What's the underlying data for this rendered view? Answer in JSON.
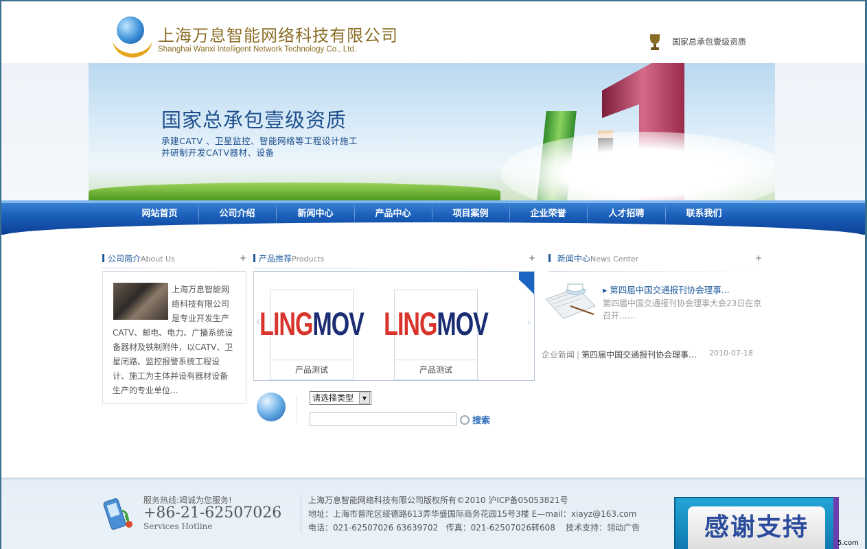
{
  "header": {
    "company_cn": "上海万息智能网络科技有限公司",
    "company_en": "Shanghai Wanxi Intelligent Network Technology Co., Ltd.",
    "qualification": "国家总承包壹级资质"
  },
  "banner": {
    "title": "国家总承包壹级资质",
    "line1": "承建CATV 、卫星监控、智能网络等工程设计施工",
    "line2": "并研制开发CATV器材、设备"
  },
  "nav": [
    "网站首页",
    "公司介绍",
    "新闻中心",
    "产品中心",
    "项目案例",
    "企业荣誉",
    "人才招聘",
    "联系我们"
  ],
  "about": {
    "title": "公司简介",
    "title_en": "About Us",
    "more": "+",
    "text": "上海万息智能网络科技有限公司是专业开发生产CATV、邮电、电力、广播系统设备器材及铁制附件，以CATV、卫星闭路、监控报警系统工程设计、施工为主体并设有器材设备生产的专业单位..."
  },
  "products": {
    "title": "产品推荐",
    "title_en": "Products",
    "more": "+",
    "items": [
      {
        "logo_a": "LING",
        "logo_b": "MOV",
        "caption": "产品测试"
      },
      {
        "logo_a": "LING",
        "logo_b": "MOV",
        "caption": "产品测试"
      }
    ]
  },
  "search": {
    "type_selected": "请选择类型",
    "keyword_value": "",
    "button_label": "搜索"
  },
  "news": {
    "title": "新闻中心",
    "title_en": "News Center",
    "more": "+",
    "headline": "第四届中国交通报刊协会理事...",
    "summary": "第四届中国交通报刊协会理事大会23日在京召开......",
    "list": [
      {
        "category": "企业新闻",
        "sep": "|",
        "title": "第四届中国交通报刊协会理事...",
        "date": "2010-07-18"
      }
    ]
  },
  "footer": {
    "hotline_label": "服务热线:竭诚为您服务!",
    "phone": "+86-21-62507026",
    "hotline_en": "Services Hotline",
    "copyright": "上海万息智能网络科技有限公司版权所有©2010 沪ICP备05053821号",
    "address": "地址：上海市普陀区绥德路613弄华盛国际商务花园15号3楼 E—mail：xiayz@163.com",
    "contact": "电话：021-62507026 63639702   传真：021-62507026转608    技术支持：翎动广告"
  },
  "overlay": {
    "thanks": "感谢支持",
    "watermark": "5.com"
  },
  "colors": {
    "nav_blue": "#1a5fba",
    "title_blue": "#1e5a9c",
    "gold": "#8a6d25"
  }
}
